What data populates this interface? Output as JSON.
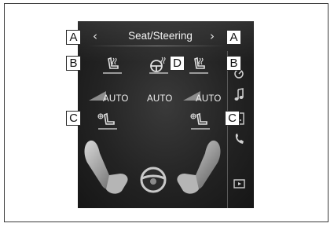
{
  "screen": {
    "title": "Seat/Steering",
    "prev_glyph": "‹",
    "next_glyph": "›",
    "auto_labels": [
      "AUTO",
      "AUTO",
      "AUTO"
    ]
  },
  "callouts": {
    "a_left": "A",
    "a_right": "A",
    "b_left": "B",
    "b_right": "B",
    "c_left": "C",
    "c_right": "C",
    "d": "D"
  },
  "icons": {
    "left_heater": "seat-heater-icon",
    "steering_heater": "steering-heater-icon",
    "right_heater": "seat-heater-icon",
    "left_ventilator": "seat-ventilator-icon",
    "right_ventilator": "seat-ventilator-icon",
    "side_tabs": [
      "climate-icon",
      "music-note-icon",
      "seat-tab-icon",
      "phone-icon",
      "media-icon"
    ]
  },
  "colors": {
    "screen_bg": "#232323",
    "text": "#f0f0f0",
    "callout_border": "#2a2a2a"
  }
}
